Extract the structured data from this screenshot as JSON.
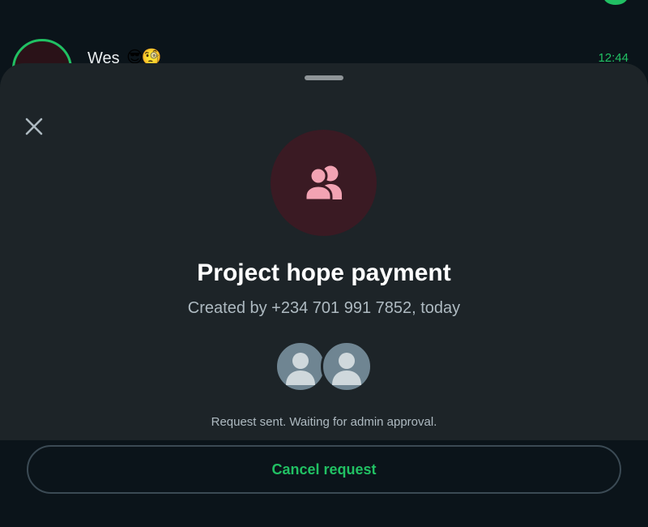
{
  "background_chat": {
    "name": "Wes",
    "emoji": "😎🧐",
    "time": "12:44"
  },
  "sheet": {
    "close_icon": "close-icon",
    "group_icon": "group-icon",
    "title": "Project hope payment",
    "subtitle": "Created by +234 701 991 7852, today",
    "status": "Request sent. Waiting for admin approval.",
    "cancel_label": "Cancel request"
  },
  "colors": {
    "accent": "#21c063",
    "sheet_bg": "#1d2428",
    "group_icon_bg": "#3a1a23",
    "group_icon_fg": "#f2a3b3"
  }
}
